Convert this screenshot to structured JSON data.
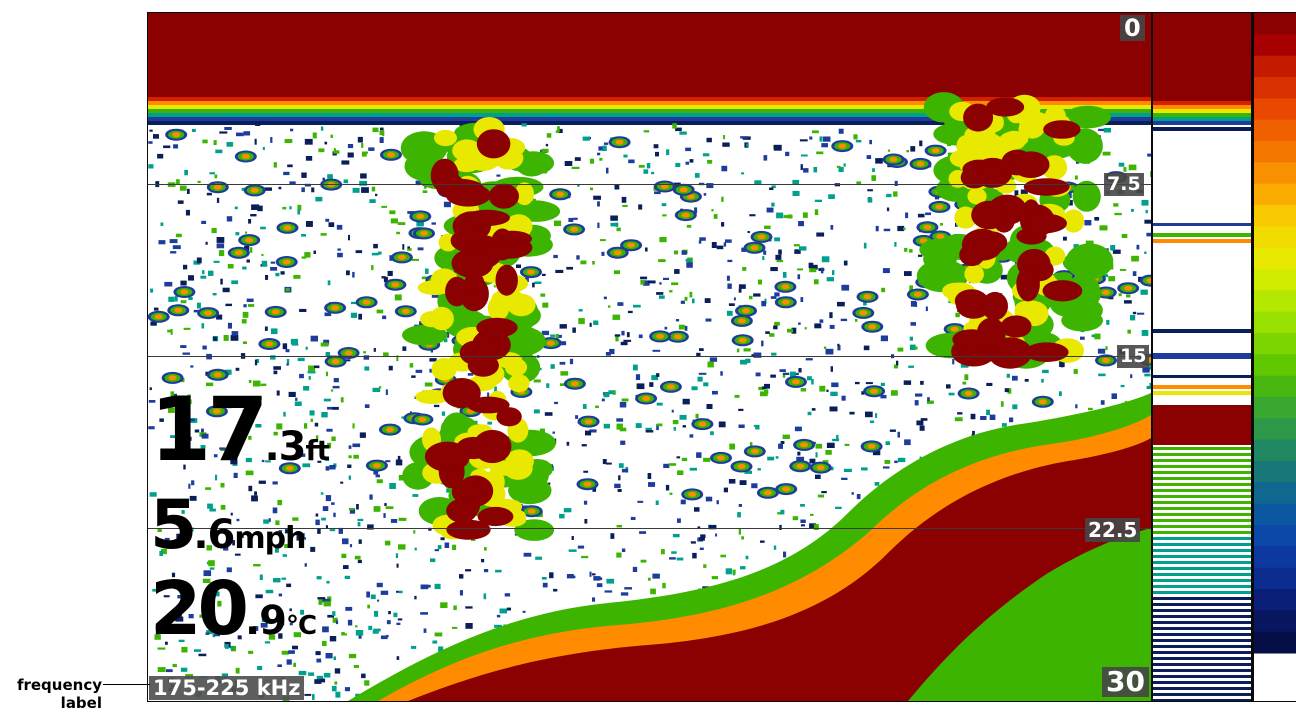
{
  "sonar": {
    "depth_scale": [
      "0",
      "7.5",
      "15",
      "22.5",
      "30"
    ],
    "colors": {
      "strong": "#8b0000",
      "red": "#d42000",
      "orange": "#ff8c00",
      "yellow": "#e8e800",
      "green": "#3cb400",
      "teal": "#00a08c",
      "blue": "#1e3c9c",
      "navy": "#0a1e5a",
      "background": "#ffffff",
      "gridline": "#3a3a3a"
    }
  },
  "readouts": {
    "depth_value": "17",
    "depth_decimal": ".3",
    "depth_unit": "ft",
    "speed_value": "5",
    "speed_decimal": ".6",
    "speed_unit": "mph",
    "temp_value": "20",
    "temp_decimal": ".9",
    "temp_unit": "°C"
  },
  "frequency": {
    "label": "175-225 kHz"
  },
  "callout": {
    "text_line1": "frequency",
    "text_line2": "label"
  }
}
